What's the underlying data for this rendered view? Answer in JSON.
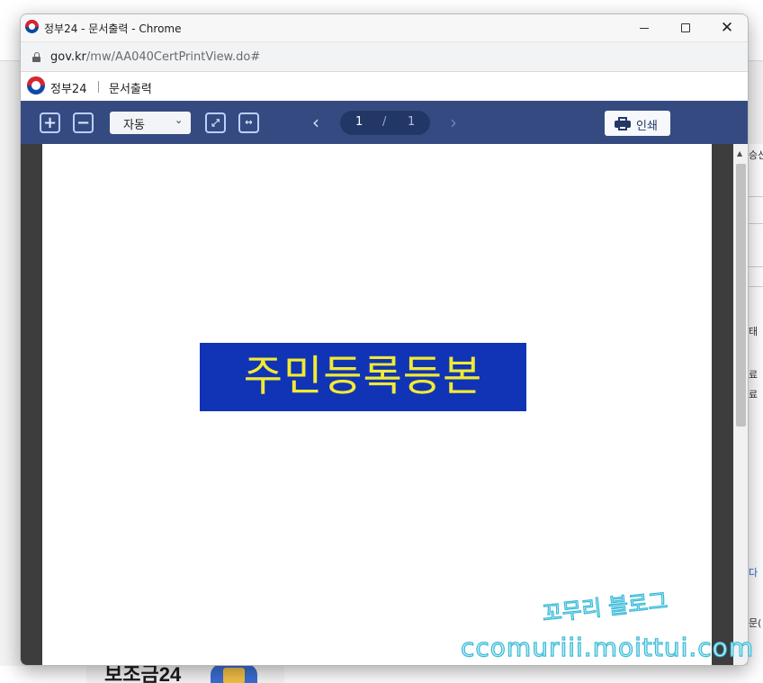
{
  "window": {
    "title": "정부24 - 문서출력 - Chrome",
    "close_glyph": "✕"
  },
  "address_bar": {
    "url_host": "gov.kr",
    "url_path": "/mw/AA040CertPrintView.do#"
  },
  "site_header": {
    "brand": "정부24",
    "page_name": "문서출력"
  },
  "toolbar": {
    "zoom_in_glyph": "+",
    "zoom_out_glyph": "−",
    "zoom_value": "자동",
    "zoom_chevron": "⌄",
    "fit_page_glyph": "⤢",
    "fit_width_glyph": "↔",
    "prev_glyph": "‹",
    "next_glyph": "›",
    "current_page": "1",
    "page_separator": "/",
    "total_pages": "1",
    "print_label": "인쇄"
  },
  "document": {
    "title": "주민등록등본",
    "title_bg_color": "#1034b5",
    "title_text_color": "#f2ea33"
  },
  "background_page": {
    "fragments": [
      "승신",
      "태",
      "료",
      "료",
      "다",
      "문("
    ],
    "logo_text": "보조금24"
  },
  "watermark": {
    "line1": "꼬무리 블로그",
    "line2": "ccomuriii.moittui.com"
  },
  "colors": {
    "toolbar_bg": "#354a81",
    "page_indicator_bg": "#233766",
    "viewer_bg": "#3d3d3d"
  }
}
